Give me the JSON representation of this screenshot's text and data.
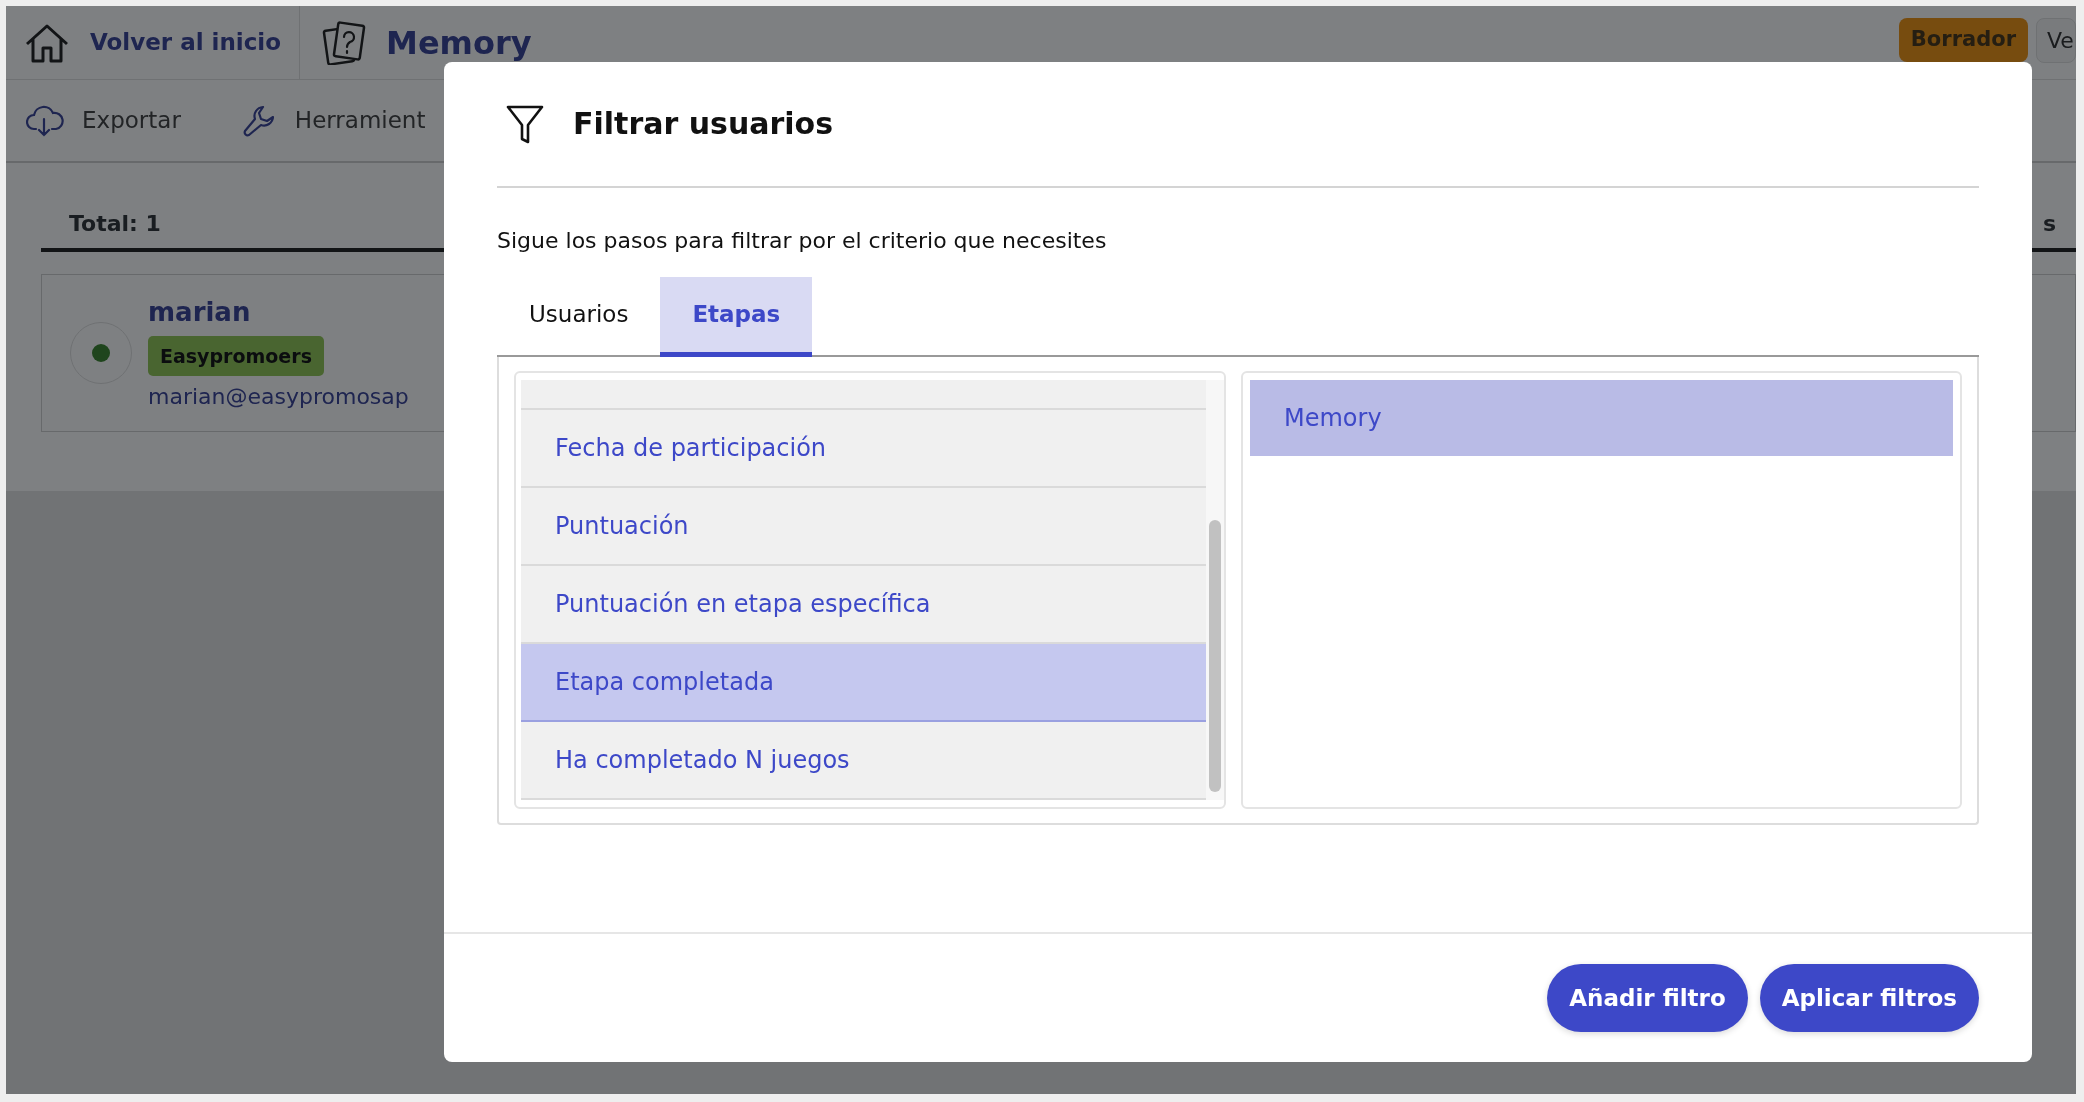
{
  "background": {
    "home_link": "Volver al inicio",
    "app_title": "Memory",
    "status_badge": "Borrador",
    "cut_button": "Ve",
    "toolbar": [
      {
        "label": "Exportar"
      },
      {
        "label": "Herramient"
      }
    ],
    "total": "Total: 1",
    "cut_label": "s",
    "user": {
      "selected": true,
      "name": "marian",
      "group": "Easypromoers",
      "email": "marian@easypromosap"
    }
  },
  "modal": {
    "title": "Filtrar usuarios",
    "subtitle": "Sigue los pasos para filtrar por el criterio que necesites",
    "tabs": [
      {
        "label": "Usuarios",
        "selected": false
      },
      {
        "label": "Etapas",
        "selected": true
      }
    ],
    "criteria": [
      {
        "label": "Fecha de participación",
        "selected": false
      },
      {
        "label": "Puntuación",
        "selected": false
      },
      {
        "label": "Puntuación en etapa específica",
        "selected": false
      },
      {
        "label": "Etapa completada",
        "selected": true
      },
      {
        "label": "Ha completado N juegos",
        "selected": false
      }
    ],
    "stages": [
      {
        "label": "Memory",
        "selected": true
      }
    ],
    "buttons": [
      {
        "label": "Añadir filtro"
      },
      {
        "label": "Aplicar filtros"
      }
    ]
  }
}
